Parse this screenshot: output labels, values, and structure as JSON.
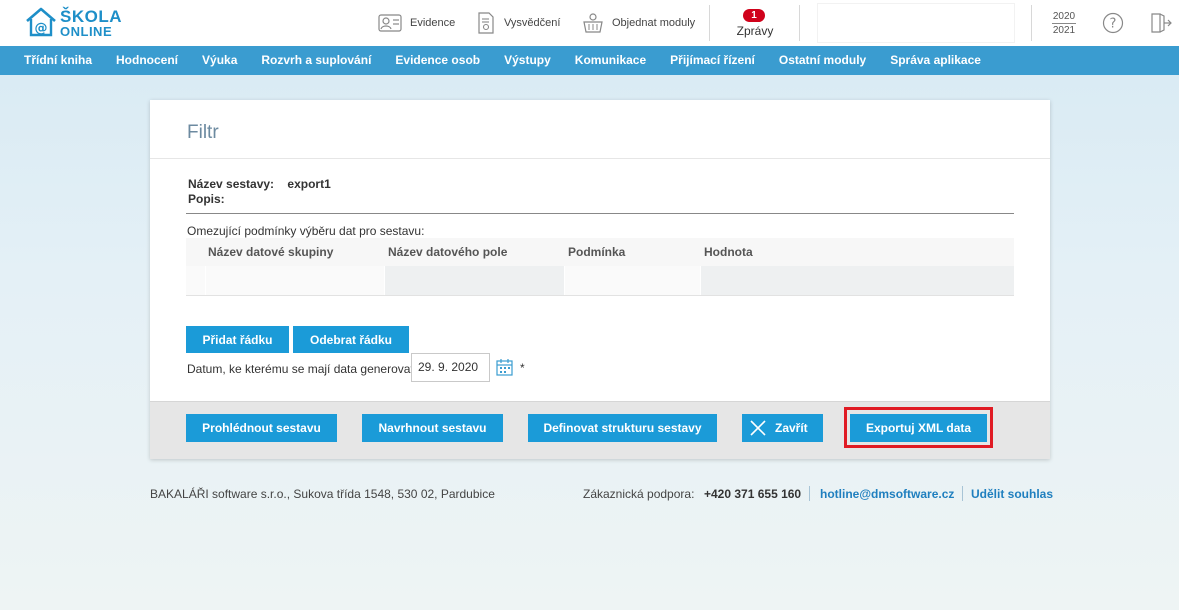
{
  "logo": {
    "line1": "ŠKOLA",
    "line2": "ONLINE",
    "color": "#1e8fc8"
  },
  "header": {
    "tools": [
      {
        "label": "Evidence",
        "icon": "person-card-icon"
      },
      {
        "label": "Vysvědčení",
        "icon": "certificate-icon"
      },
      {
        "label": "Objednat moduly",
        "icon": "basket-icon"
      }
    ],
    "messages": {
      "count": "1",
      "label": "Zprávy"
    },
    "years": {
      "from": "2020",
      "to": "2021"
    }
  },
  "nav": {
    "items": [
      "Třídní kniha",
      "Hodnocení",
      "Výuka",
      "Rozvrh a suplování",
      "Evidence osob",
      "Výstupy",
      "Komunikace",
      "Přijímací řízení",
      "Ostatní moduly",
      "Správa aplikace"
    ],
    "color": "#3a9cd0"
  },
  "filter": {
    "title": "Filtr",
    "report_name_label": "Název sestavy:",
    "report_name_value": "export1",
    "description_label": "Popis:",
    "conditions_label": "Omezující podmínky výběru dat pro sestavu:",
    "table": {
      "columns": [
        "Název datové skupiny",
        "Název datového pole",
        "Podmínka",
        "Hodnota"
      ],
      "rows": [
        [
          "",
          "",
          "",
          ""
        ]
      ]
    },
    "add_row_label": "Přidat řádku",
    "remove_row_label": "Odebrat řádku",
    "date_label": "Datum, ke kterému se mají data generovat:",
    "date_value": "29. 9. 2020",
    "required_mark": "*"
  },
  "actions": {
    "view_label": "Prohlédnout sestavu",
    "design_label": "Navrhnout sestavu",
    "define_label": "Definovat strukturu sestavy",
    "close_label": "Zavřít",
    "export_label": "Exportuj XML data",
    "highlight_color": "#e01b24",
    "button_color": "#1b9bd8"
  },
  "footer": {
    "company": "BAKALÁŘI software s.r.o., Sukova třída 1548, 530 02, Pardubice",
    "support_label": "Zákaznická podpora:",
    "phone": "+420 371 655 160",
    "email": "hotline@dmsoftware.cz",
    "consent": "Udělit souhlas"
  }
}
